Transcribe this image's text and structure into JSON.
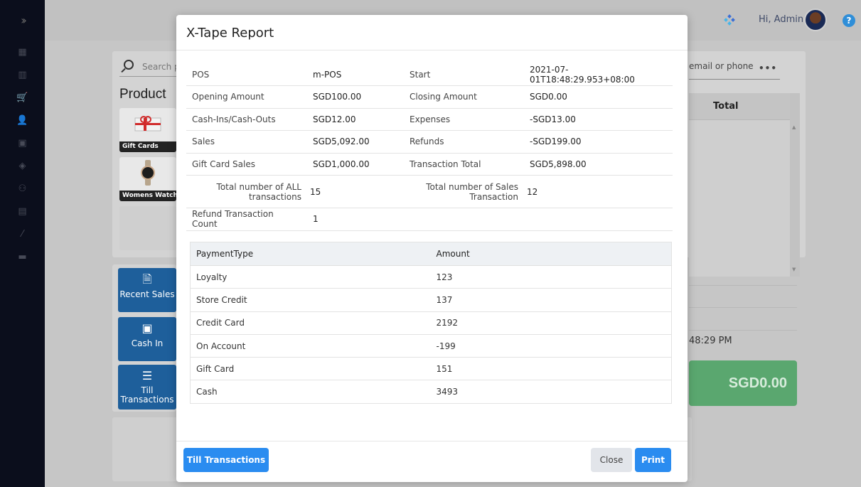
{
  "app": {
    "sidebar_toggle": "››",
    "nav_icons": [
      {
        "name": "dashboard-icon",
        "glyph": "▦"
      },
      {
        "name": "reports-icon",
        "glyph": "▥"
      },
      {
        "name": "cart-icon",
        "glyph": "🛒"
      },
      {
        "name": "customers-icon",
        "glyph": "👤"
      },
      {
        "name": "store-icon",
        "glyph": "▣"
      },
      {
        "name": "products-icon",
        "glyph": "◈"
      },
      {
        "name": "staff-icon",
        "glyph": "⚇"
      },
      {
        "name": "gift-icon",
        "glyph": "▤"
      },
      {
        "name": "discount-icon",
        "glyph": "⁄"
      },
      {
        "name": "toggle-icon",
        "glyph": "▬"
      }
    ],
    "greeting": "Hi, Admin",
    "help": "?",
    "search_placeholder": "Search p",
    "product_title": "Product",
    "products": [
      {
        "caption": "Gift Cards"
      },
      {
        "caption": "Womens Watch..."
      }
    ],
    "actions": [
      {
        "label": "Recent Sales",
        "icon": "🗎"
      },
      {
        "label": "Cash In",
        "icon": "▣"
      },
      {
        "label": "Till Transactions",
        "icon": "☰"
      }
    ],
    "customer_placeholder": "email or phone",
    "customer_more": "•••",
    "cart_header": "Total",
    "time_text": "48:29 PM",
    "total_amount": "SGD0.00"
  },
  "modal": {
    "title": "X-Tape Report",
    "rows": [
      [
        "POS",
        "m-POS",
        "Start",
        "2021-07-01T18:48:29.953+08:00"
      ],
      [
        "Opening Amount",
        "SGD100.00",
        "Closing Amount",
        "SGD0.00"
      ],
      [
        "Cash-Ins/Cash-Outs",
        "SGD12.00",
        "Expenses",
        "-SGD13.00"
      ],
      [
        "Sales",
        "SGD5,092.00",
        "Refunds",
        "-SGD199.00"
      ],
      [
        "Gift Card Sales",
        "SGD1,000.00",
        "Transaction Total",
        "SGD5,898.00"
      ]
    ],
    "total_all_label_1": "Total number of ALL",
    "total_all_label_2": "transactions",
    "total_all_value": "15",
    "total_sales_label_1": "Total number of Sales",
    "total_sales_label_2": "Transaction",
    "total_sales_value": "12",
    "refund_count_label": "Refund Transaction Count",
    "refund_count_value": "1",
    "payment_header": [
      "PaymentType",
      "Amount"
    ],
    "payments": [
      [
        "Loyalty",
        "123"
      ],
      [
        "Store Credit",
        "137"
      ],
      [
        "Credit Card",
        "2192"
      ],
      [
        "On Account",
        "-199"
      ],
      [
        "Gift Card",
        "151"
      ],
      [
        "Cash",
        "3493"
      ]
    ],
    "buttons": {
      "till": "Till Transactions",
      "close": "Close",
      "print": "Print"
    }
  },
  "colors": {
    "primary": "#2a8cf0",
    "sidebar": "#0b0e1c",
    "total_green": "#5aa76f"
  }
}
